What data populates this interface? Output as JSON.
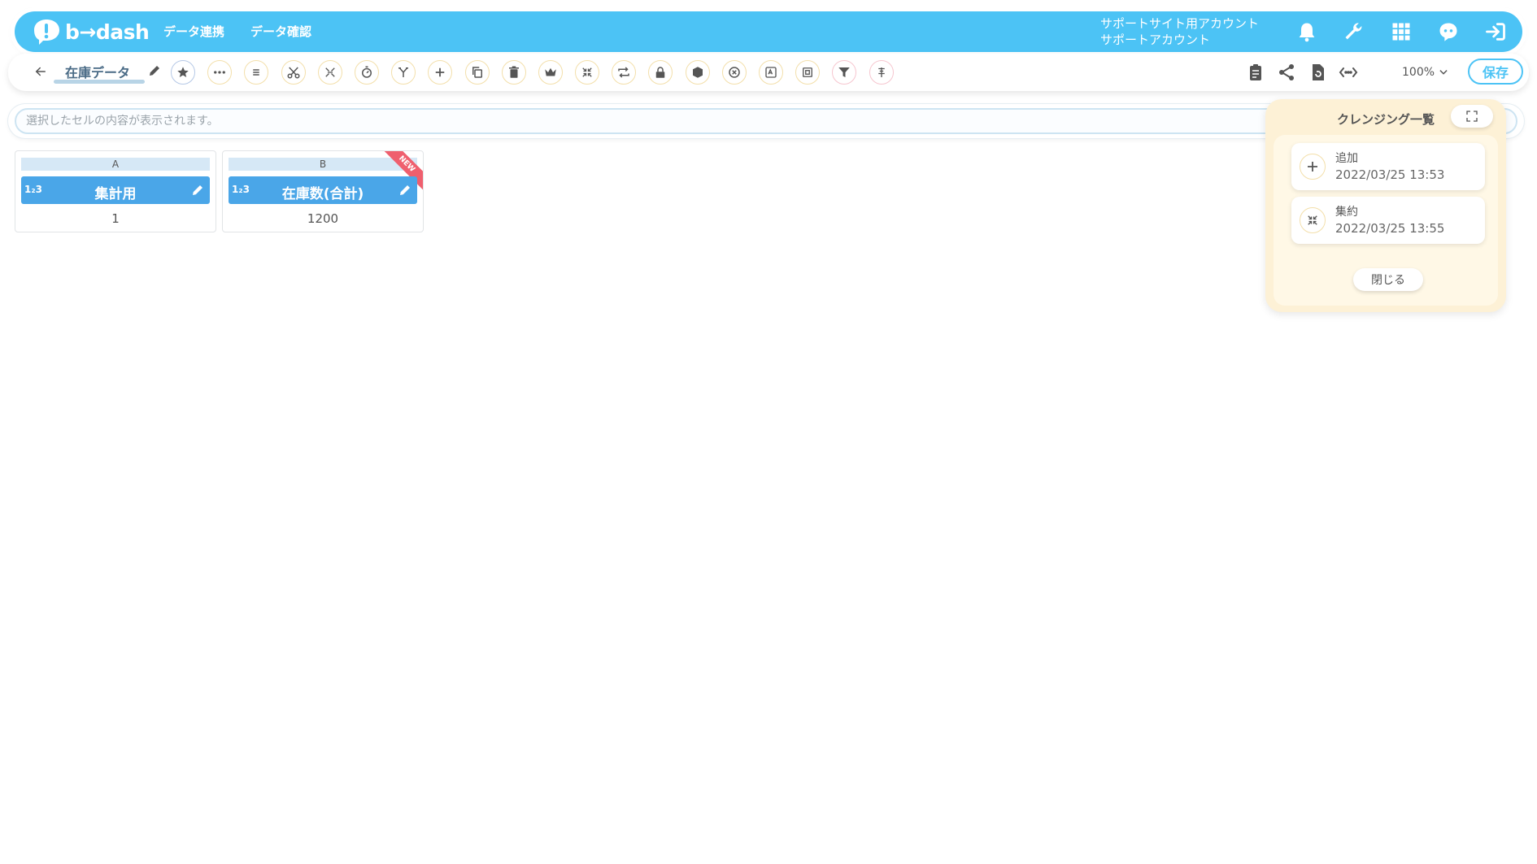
{
  "header": {
    "logo_text": "b→dash",
    "nav": [
      "データ連携",
      "データ確認"
    ],
    "account_line1": "サポートサイト用アカウント",
    "account_line2": "サポートアカウント",
    "icons": [
      "bell-icon",
      "wrench-icon",
      "grid-icon",
      "chat-icon",
      "logout-icon"
    ]
  },
  "toolbar": {
    "title": "在庫データ",
    "tools": [
      "star-icon",
      "more-icon",
      "list-icon",
      "scissors-icon",
      "aggregate-icon",
      "timer-icon",
      "branch-icon",
      "plus-icon",
      "copy-icon",
      "trash-icon",
      "crown-icon",
      "collapse-icon",
      "repeat-icon",
      "lock-icon",
      "box-icon",
      "cancel-icon",
      "convert-icon",
      "frame-icon",
      "filter-icon",
      "sparkle-icon"
    ],
    "right_icons": [
      "clipboard-icon",
      "share-icon",
      "refresh-icon",
      "code-icon"
    ],
    "zoom": "100%",
    "save_label": "保存"
  },
  "cellbar": {
    "placeholder": "選択したセルの内容が表示されます。"
  },
  "columns": [
    {
      "letter": "A",
      "type": "1₂3",
      "name": "集計用",
      "value": "1",
      "is_new": false
    },
    {
      "letter": "B",
      "type": "1₂3",
      "name": "在庫数(合計)",
      "value": "1200",
      "is_new": true,
      "badge": "NEW"
    }
  ],
  "panel": {
    "title": "クレンジング一覧",
    "steps": [
      {
        "name": "追加",
        "date": "2022/03/25 13:53"
      },
      {
        "name": "集約",
        "date": "2022/03/25 13:55"
      }
    ],
    "close_label": "閉じる"
  },
  "colors": {
    "header_bg": "#4cc3f5",
    "column_head": "#4aa6e8",
    "panel_bg": "#fdf1d6",
    "new_badge": "#ef5f6e"
  }
}
